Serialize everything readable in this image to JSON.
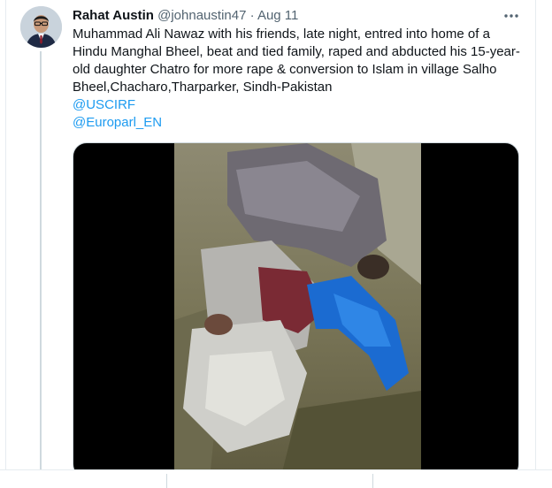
{
  "tweet": {
    "author": {
      "name": "Rahat Austin",
      "handle": "@johnaustin47",
      "separator": "·",
      "date": "Aug 11",
      "avatar_icon": "profile-photo"
    },
    "more_icon": "more-horizontal-icon",
    "text_lines": [
      "Muhammad Ali Nawaz with his friends, late night, entred into home of a Hindu Manghal Bheel, beat and tied family, raped and abducted his 15-year-old daughter Chatro for more rape & conversion to Islam in village Salho Bheel,Chacharo,Tharparker, Sindh-Pakistan"
    ],
    "mentions": [
      "@USCIRF",
      "@Europarl_EN"
    ],
    "media": {
      "type": "video",
      "thumbnail_icon": "video-thumbnail"
    }
  },
  "colors": {
    "link": "#1d9bf0",
    "secondary_text": "#536471",
    "primary_text": "#0f1419",
    "border": "#e6ecf0"
  }
}
